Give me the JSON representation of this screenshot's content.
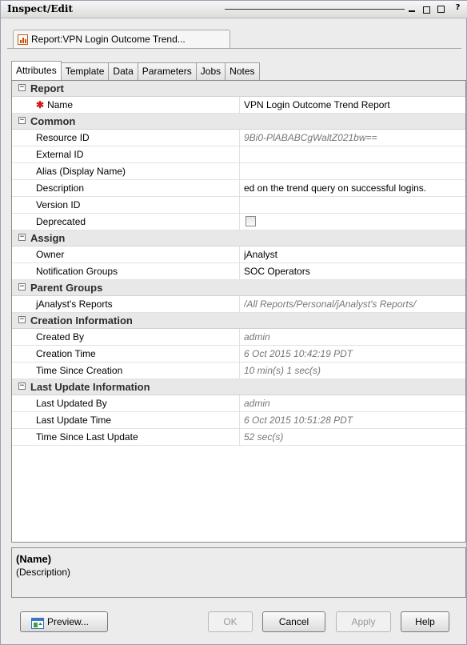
{
  "window": {
    "title": "Inspect/Edit"
  },
  "doc_tab": {
    "label": "Report:VPN Login Outcome Trend..."
  },
  "tabs": [
    "Attributes",
    "Template",
    "Data",
    "Parameters",
    "Jobs",
    "Notes"
  ],
  "sections": {
    "report": {
      "title": "Report",
      "rows": {
        "name": {
          "key": "Name",
          "value": "VPN Login Outcome Trend Report"
        }
      }
    },
    "common": {
      "title": "Common",
      "rows": {
        "resource_id": {
          "key": "Resource ID",
          "value": "9Bi0-PlABABCgWaltZ021bw=="
        },
        "external_id": {
          "key": "External ID",
          "value": ""
        },
        "alias": {
          "key": "Alias (Display Name)",
          "value": ""
        },
        "description": {
          "key": "Description",
          "value": "ed on the trend query on successful logins."
        },
        "version_id": {
          "key": "Version ID",
          "value": ""
        },
        "deprecated": {
          "key": "Deprecated",
          "checked": false
        }
      }
    },
    "assign": {
      "title": "Assign",
      "rows": {
        "owner": {
          "key": "Owner",
          "value": "jAnalyst"
        },
        "notification_groups": {
          "key": "Notification Groups",
          "value": "SOC Operators"
        }
      }
    },
    "parent_groups": {
      "title": "Parent Groups",
      "rows": {
        "reports": {
          "key": "jAnalyst's Reports",
          "value": "/All Reports/Personal/jAnalyst's Reports/"
        }
      }
    },
    "creation": {
      "title": "Creation Information",
      "rows": {
        "created_by": {
          "key": "Created By",
          "value": "admin"
        },
        "creation_time": {
          "key": "Creation Time",
          "value": "6 Oct 2015 10:42:19 PDT"
        },
        "time_since_creation": {
          "key": "Time Since Creation",
          "value": "10 min(s) 1 sec(s)"
        }
      }
    },
    "last_update": {
      "title": "Last Update Information",
      "rows": {
        "last_updated_by": {
          "key": "Last Updated By",
          "value": "admin"
        },
        "last_update_time": {
          "key": "Last Update Time",
          "value": "6 Oct 2015 10:51:28 PDT"
        },
        "time_since_last_update": {
          "key": "Time Since Last Update",
          "value": "52 sec(s)"
        }
      }
    }
  },
  "description_pane": {
    "name": "(Name)",
    "text": "(Description)"
  },
  "buttons": {
    "preview": "Preview...",
    "ok": "OK",
    "cancel": "Cancel",
    "apply": "Apply",
    "help": "Help"
  },
  "icons": {
    "report_tab": "bar-chart-icon",
    "preview": "preview-icon",
    "toggle": "collapse-minus-icon"
  },
  "colors": {
    "required_marker": "#d11a1a",
    "category_bg": "#e8e8e8",
    "readonly_text": "#777777"
  }
}
